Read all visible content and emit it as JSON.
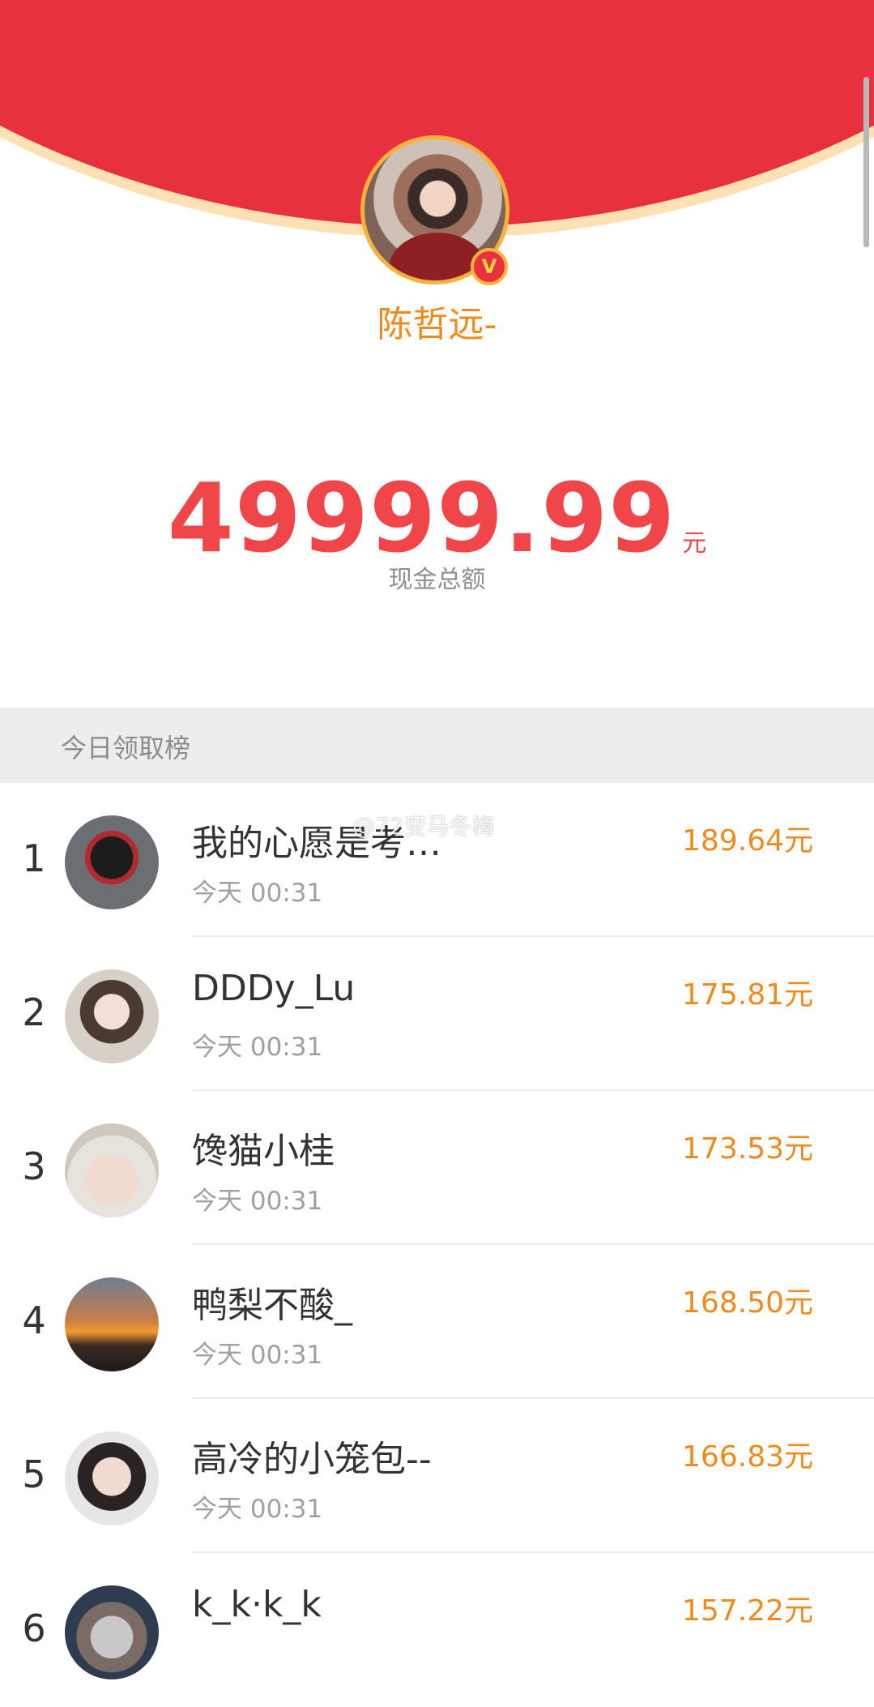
{
  "profile": {
    "name": "陈哲远-",
    "verified_mark": "V"
  },
  "summary": {
    "amount": "49999.99",
    "unit": "元",
    "label": "现金总额"
  },
  "leaderboard": {
    "title": "今日领取榜",
    "watermark": "@72变马冬梅",
    "rows": [
      {
        "rank": "1",
        "name": "我的心愿是考…",
        "time": "今天 00:31",
        "amount": "189.64元"
      },
      {
        "rank": "2",
        "name": "DDDy_Lu",
        "time": "今天 00:31",
        "amount": "175.81元"
      },
      {
        "rank": "3",
        "name": "馋猫小桂",
        "time": "今天 00:31",
        "amount": "173.53元"
      },
      {
        "rank": "4",
        "name": "鸭梨不酸_",
        "time": "今天 00:31",
        "amount": "168.50元"
      },
      {
        "rank": "5",
        "name": "高冷的小笼包--",
        "time": "今天 00:31",
        "amount": "166.83元"
      },
      {
        "rank": "6",
        "name": "k_k·k_k",
        "time": "",
        "amount": "157.22元"
      }
    ]
  },
  "colors": {
    "header_red": "#e8313e",
    "accent_orange": "#f08a1d",
    "amount_red": "#f0464a"
  }
}
